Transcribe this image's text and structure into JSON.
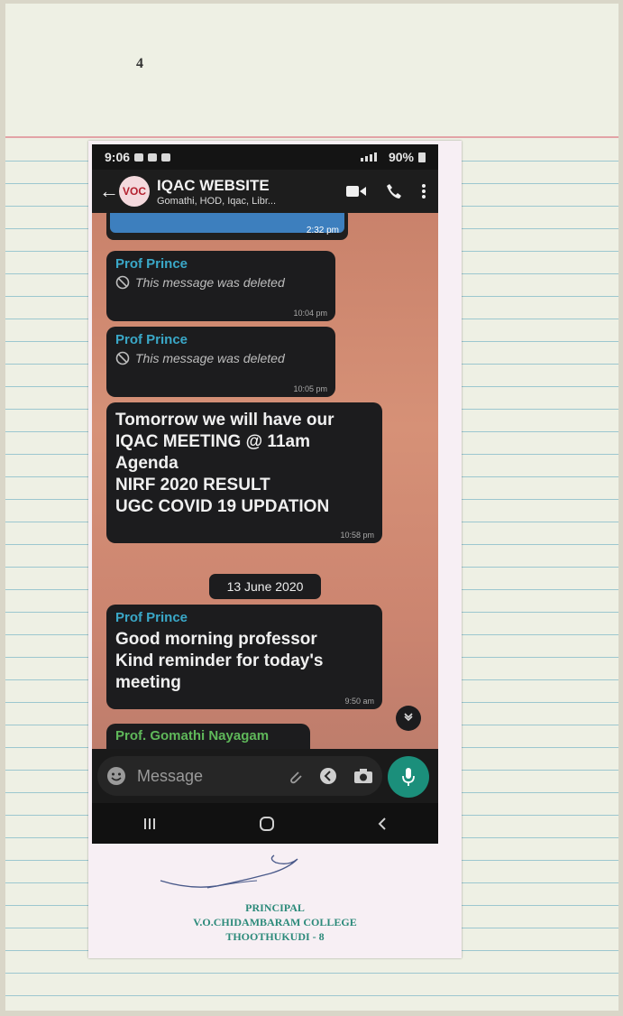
{
  "page": {
    "number": "4"
  },
  "status_bar": {
    "time": "9:06",
    "battery": "90%"
  },
  "chat_header": {
    "title": "IQAC WEBSITE",
    "subtitle": "Gomathi, HOD, Iqac, Libr..."
  },
  "messages": [
    {
      "type": "image",
      "time": "2:32 pm"
    },
    {
      "type": "deleted",
      "sender": "Prof Prince",
      "text": "This message was deleted",
      "time": "10:04 pm"
    },
    {
      "type": "deleted",
      "sender": "Prof Prince",
      "text": "This message was deleted",
      "time": "10:05 pm"
    },
    {
      "type": "text",
      "text": "Tomorrow we will have our\nIQAC MEETING @ 11am\nAgenda\nNIRF 2020 RESULT\nUGC COVID 19 UPDATION",
      "time": "10:58 pm"
    },
    {
      "type": "date",
      "text": "13 June 2020"
    },
    {
      "type": "text",
      "sender": "Prof Prince",
      "text": "Good morning professor\nKind reminder for today's\nmeeting",
      "time": "9:50 am"
    },
    {
      "type": "partial",
      "sender": "Prof. Gomathi Nayagam"
    }
  ],
  "composer": {
    "placeholder": "Message"
  },
  "seal": {
    "line1": "PRINCIPAL",
    "line2": "V.O.CHIDAMBARAM COLLEGE",
    "line3": "THOOTHUKUDI - 8"
  },
  "colors": {
    "sender_name": "#3aa8c8",
    "sender_alt": "#5fb85a",
    "mic_button": "#1b8f7b",
    "chat_wallpaper": "#d69177",
    "seal_ink": "#2c8a7a"
  }
}
